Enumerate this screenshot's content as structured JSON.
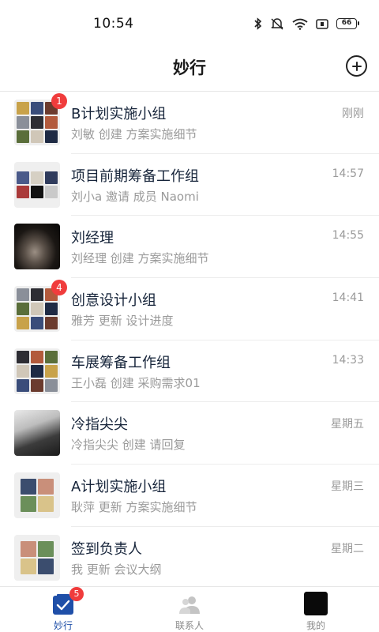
{
  "status_bar": {
    "time": "10:54",
    "battery": "66"
  },
  "header": {
    "title": "妙行"
  },
  "conversations": [
    {
      "title": "B计划实施小组",
      "subtitle": "刘敏 创建 方案实施细节",
      "time": "刚刚",
      "unread": "1",
      "avatar_type": "group9"
    },
    {
      "title": "项目前期筹备工作组",
      "subtitle": "刘小a 邀请 成员 Naomi",
      "time": "14:57",
      "unread": "",
      "avatar_type": "group6"
    },
    {
      "title": "刘经理",
      "subtitle": "刘经理 创建 方案实施细节",
      "time": "14:55",
      "unread": "",
      "avatar_type": "photo-cat"
    },
    {
      "title": "创意设计小组",
      "subtitle": "雅芳 更新 设计进度",
      "time": "14:41",
      "unread": "4",
      "avatar_type": "group9"
    },
    {
      "title": "车展筹备工作组",
      "subtitle": "王小磊 创建 采购需求01",
      "time": "14:33",
      "unread": "",
      "avatar_type": "group9"
    },
    {
      "title": "冷指尖尖",
      "subtitle": "冷指尖尖 创建 请回复",
      "time": "星期五",
      "unread": "",
      "avatar_type": "photo-person"
    },
    {
      "title": "A计划实施小组",
      "subtitle": "耿萍 更新 方案实施细节",
      "time": "星期三",
      "unread": "",
      "avatar_type": "group4"
    },
    {
      "title": "签到负责人",
      "subtitle": "我 更新 会议大纲",
      "time": "星期二",
      "unread": "",
      "avatar_type": "group4"
    }
  ],
  "tabbar": {
    "tabs": [
      {
        "label": "妙行",
        "icon": "checkbox-icon",
        "active": true,
        "badge": "5"
      },
      {
        "label": "联系人",
        "icon": "contacts-icon",
        "active": false,
        "badge": ""
      },
      {
        "label": "我的",
        "icon": "profile-icon",
        "active": false,
        "badge": ""
      }
    ]
  },
  "colors": {
    "accent": "#1f4fa8",
    "badge": "#f03c3c",
    "title": "#16243a",
    "muted": "#9a9a9a"
  }
}
